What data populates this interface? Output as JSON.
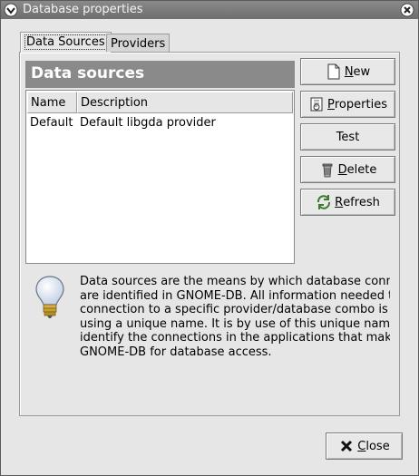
{
  "window": {
    "title": "Database properties"
  },
  "tabs": [
    {
      "label": "Data Sources",
      "active": true
    },
    {
      "label": "Providers",
      "active": false
    }
  ],
  "panel": {
    "header": "Data sources",
    "columns": [
      "Name",
      "Description"
    ],
    "rows": [
      {
        "name": "Default",
        "description": "Default libgda provider"
      }
    ]
  },
  "buttons": {
    "new": {
      "mnemonic": "N",
      "rest": "ew"
    },
    "properties": {
      "mnemonic": "P",
      "rest": "roperties"
    },
    "test": {
      "label": "Test"
    },
    "delete": {
      "mnemonic": "D",
      "rest": "elete"
    },
    "refresh": {
      "mnemonic": "R",
      "rest": "efresh"
    },
    "close": {
      "mnemonic": "C",
      "rest": "lose"
    }
  },
  "info_lines": [
    "Data sources are the means by which database conn",
    "are identified in GNOME-DB. All information needed tc",
    "connection to a specific provider/database combo is",
    "using a unique name. It is by use of this unique name",
    "identify the connections in the applications that make",
    "GNOME-DB for database access."
  ]
}
